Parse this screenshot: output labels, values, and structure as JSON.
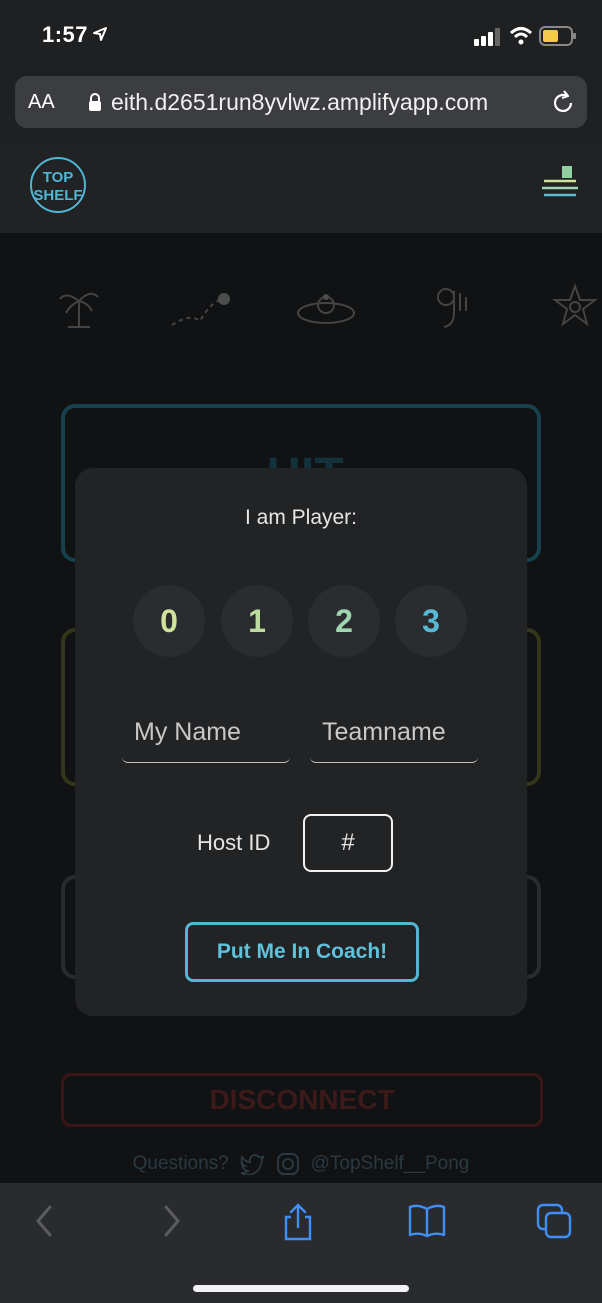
{
  "status_bar": {
    "time": "1:57"
  },
  "browser": {
    "text_size_label": "AA",
    "url": "eith.d2651run8yvlwz.amplifyapp.com"
  },
  "header": {
    "logo_text": [
      "TOP",
      "SHELF"
    ]
  },
  "background": {
    "hit_label": "HIT",
    "disconnect_label": "DISCONNECT",
    "questions_label": "Questions?",
    "handle": "@TopShelf__Pong"
  },
  "modal": {
    "title": "I am Player:",
    "players": [
      {
        "label": "0",
        "color": "#cfe39a"
      },
      {
        "label": "1",
        "color": "#bcdba0"
      },
      {
        "label": "2",
        "color": "#9fd6b0"
      },
      {
        "label": "3",
        "color": "#58b9d4"
      }
    ],
    "name_placeholder": "My Name",
    "team_placeholder": "Teamname",
    "host_label": "Host ID",
    "host_placeholder": "#",
    "submit_label": "Put Me In Coach!"
  },
  "colors": {
    "accent": "#4fb6d3",
    "background": "#1f2022",
    "modal": "#222325"
  }
}
